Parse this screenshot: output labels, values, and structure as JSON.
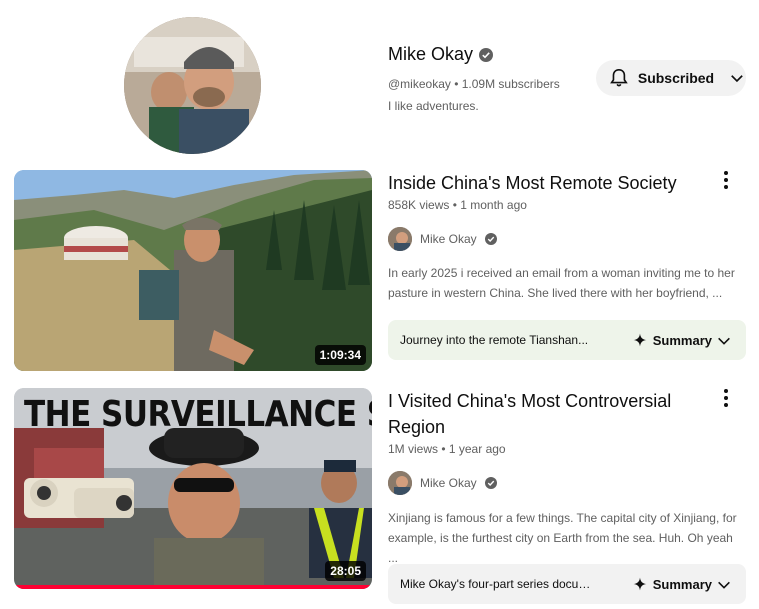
{
  "channel": {
    "name": "Mike Okay",
    "handle_subs": "@mikeokay • 1.09M subscribers",
    "description": "I like adventures.",
    "subscribe_label": "Subscribed"
  },
  "videos": [
    {
      "title": "Inside China's Most Remote Society",
      "meta": "858K views • 1 month ago",
      "channel": "Mike Okay",
      "description": "In early 2025 i received an email from a woman inviting me to her pasture in western China. She lived there with her boyfriend, ...",
      "duration": "1:09:34",
      "summary_text": "Journey into the remote Tianshan...",
      "summary_label": "Summary"
    },
    {
      "title": "I Visited China's Most Controversial Region",
      "meta": "1M views • 1 year ago",
      "channel": "Mike Okay",
      "description": "Xinjiang is famous for a few things. The capital city of Xinjiang, for example, is the furthest city on Earth from the sea. Huh. Oh yeah ...",
      "duration": "28:05",
      "thumb_text": "THE SURVEILLANCE STATE",
      "summary_text": "Mike Okay's four-part series document...",
      "summary_label": "Summary",
      "watched_progress": 1.0
    }
  ],
  "colors": {
    "accent_progress": "#ff0033",
    "summary_bg_1": "#eef4ea",
    "summary_bg_2": "#f2f2f2",
    "subscribed_bg": "#f2f2f2"
  },
  "icons": {
    "verified": "check-circle-icon",
    "bell": "bell-icon",
    "chevron": "chevron-down-icon",
    "sparkle": "sparkle-icon",
    "more": "vertical-dots-icon"
  }
}
